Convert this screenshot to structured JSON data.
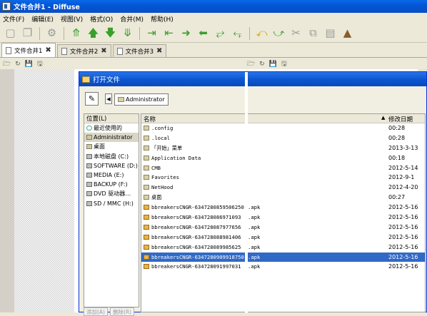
{
  "window": {
    "title": "文件合并1 - Diffuse"
  },
  "menu": [
    "文件(F)",
    "编辑(E)",
    "视图(V)",
    "格式(O)",
    "合并(M)",
    "帮助(H)"
  ],
  "toolbar": [
    {
      "icon": "new-file-icon"
    },
    {
      "icon": "copy-file-icon"
    },
    {
      "icon": "settings-gear-icon"
    },
    {
      "icon": "first-difference-icon"
    },
    {
      "icon": "previous-difference-icon"
    },
    {
      "icon": "next-difference-icon"
    },
    {
      "icon": "last-difference-icon"
    },
    {
      "icon": "copy-right-icon"
    },
    {
      "icon": "copy-left-right-icon"
    },
    {
      "icon": "merge-right-icon"
    },
    {
      "icon": "merge-left-icon"
    },
    {
      "icon": "merge-both-icon"
    },
    {
      "icon": "swap-icon"
    },
    {
      "icon": "undo-icon"
    },
    {
      "icon": "redo-icon"
    },
    {
      "icon": "cut-icon"
    },
    {
      "icon": "copy-icon"
    },
    {
      "icon": "paste-icon"
    },
    {
      "icon": "clear-edits-icon"
    }
  ],
  "tabs": [
    {
      "label": "文件合并1",
      "active": true
    },
    {
      "label": "文件合并2",
      "active": false
    },
    {
      "label": "文件合并3",
      "active": false
    }
  ],
  "dialog": {
    "title": "打开文件",
    "breadcrumb": "Administrator",
    "places_header": "位置(L)",
    "places": [
      {
        "label": "最近使用的",
        "icon": "recent-icon"
      },
      {
        "label": "Administrator",
        "icon": "home-folder-icon",
        "selected": true
      },
      {
        "label": "桌面",
        "icon": "desktop-folder-icon"
      },
      {
        "label": "本地磁盘 (C:)",
        "icon": "drive-icon"
      },
      {
        "label": "SOFTWARE (D:)",
        "icon": "drive-icon"
      },
      {
        "label": "MEDIA (E:)",
        "icon": "drive-icon"
      },
      {
        "label": "BACKUP (F:)",
        "icon": "drive-icon"
      },
      {
        "label": "DVD 驱动器…",
        "icon": "dvd-drive-icon"
      },
      {
        "label": "SD / MMC (H:)",
        "icon": "sd-card-icon"
      }
    ],
    "places_buttons": {
      "add": "添加(A)",
      "remove": "删除(R)"
    },
    "columns": {
      "name": "名称",
      "date": "修改日期"
    },
    "files": [
      {
        "name": ".config",
        "ext": "",
        "date": "00:28",
        "type": "folder"
      },
      {
        "name": ".local",
        "ext": "",
        "date": "00:28",
        "type": "folder"
      },
      {
        "name": "「开始」菜单",
        "ext": "",
        "date": "2013-3-13",
        "type": "folder"
      },
      {
        "name": "Application Data",
        "ext": "",
        "date": "00:18",
        "type": "folder"
      },
      {
        "name": "CMB",
        "ext": "",
        "date": "2012-5-14",
        "type": "folder"
      },
      {
        "name": "Favorites",
        "ext": "",
        "date": "2012-9-1",
        "type": "folder"
      },
      {
        "name": "NetHood",
        "ext": "",
        "date": "2012-4-20",
        "type": "folder"
      },
      {
        "name": "桌面",
        "ext": "",
        "date": "00:27",
        "type": "folder"
      },
      {
        "name": "bbreakersCNGR-6347280859506250",
        "ext": ".apk",
        "date": "2012-5-16",
        "type": "apk"
      },
      {
        "name": "bbreakersCNGR-634728086971093",
        "ext": ".apk",
        "date": "2012-5-16",
        "type": "apk"
      },
      {
        "name": "bbreakersCNGR-634728087977656",
        "ext": ".apk",
        "date": "2012-5-16",
        "type": "apk"
      },
      {
        "name": "bbreakersCNGR-634728088981406",
        "ext": ".apk",
        "date": "2012-5-16",
        "type": "apk"
      },
      {
        "name": "bbreakersCNGR-634728089985625",
        "ext": ".apk",
        "date": "2012-5-16",
        "type": "apk"
      },
      {
        "name": "bbreakersCNGR-6347280909918750",
        "ext": ".apk",
        "date": "2012-5-16",
        "type": "apk",
        "selected": true
      },
      {
        "name": "bbreakersCNGR-634728091997031",
        "ext": ".apk",
        "date": "2012-5-16",
        "type": "apk"
      }
    ]
  }
}
